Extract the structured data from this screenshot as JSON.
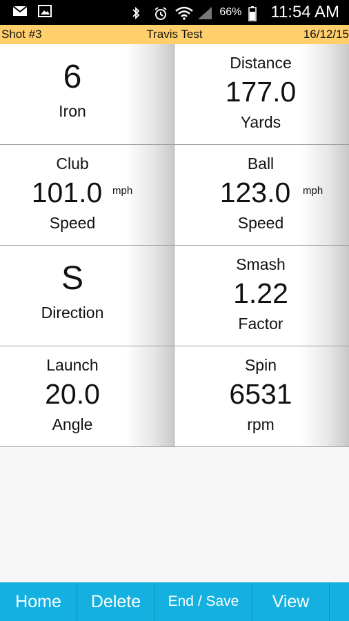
{
  "status_bar": {
    "battery_percent": "66%",
    "time": "11:54 AM",
    "icons": [
      "gmail-icon",
      "gallery-icon",
      "bluetooth-icon",
      "alarm-icon",
      "wifi-icon",
      "signal-icon",
      "battery-icon"
    ]
  },
  "info_bar": {
    "shot": "Shot #3",
    "name": "Travis Test",
    "date": "16/12/15"
  },
  "cells": {
    "club": {
      "value": "6",
      "label": "Iron"
    },
    "distance": {
      "title": "Distance",
      "value": "177.0",
      "unit": "Yards"
    },
    "club_speed": {
      "title": "Club",
      "value": "101.0",
      "unit": "mph",
      "label": "Speed"
    },
    "ball_speed": {
      "title": "Ball",
      "value": "123.0",
      "unit": "mph",
      "label": "Speed"
    },
    "direction": {
      "value": "S",
      "label": "Direction"
    },
    "smash": {
      "title": "Smash",
      "value": "1.22",
      "label": "Factor"
    },
    "launch": {
      "title": "Launch",
      "value": "20.0",
      "label": "Angle"
    },
    "spin": {
      "title": "Spin",
      "value": "6531",
      "unit": "rpm"
    }
  },
  "bottom_nav": {
    "home": "Home",
    "delete": "Delete",
    "end_save": "End / Save",
    "view": "View"
  },
  "colors": {
    "info_bar_bg": "#ffcf6b",
    "nav_bg": "#13b0e0"
  }
}
